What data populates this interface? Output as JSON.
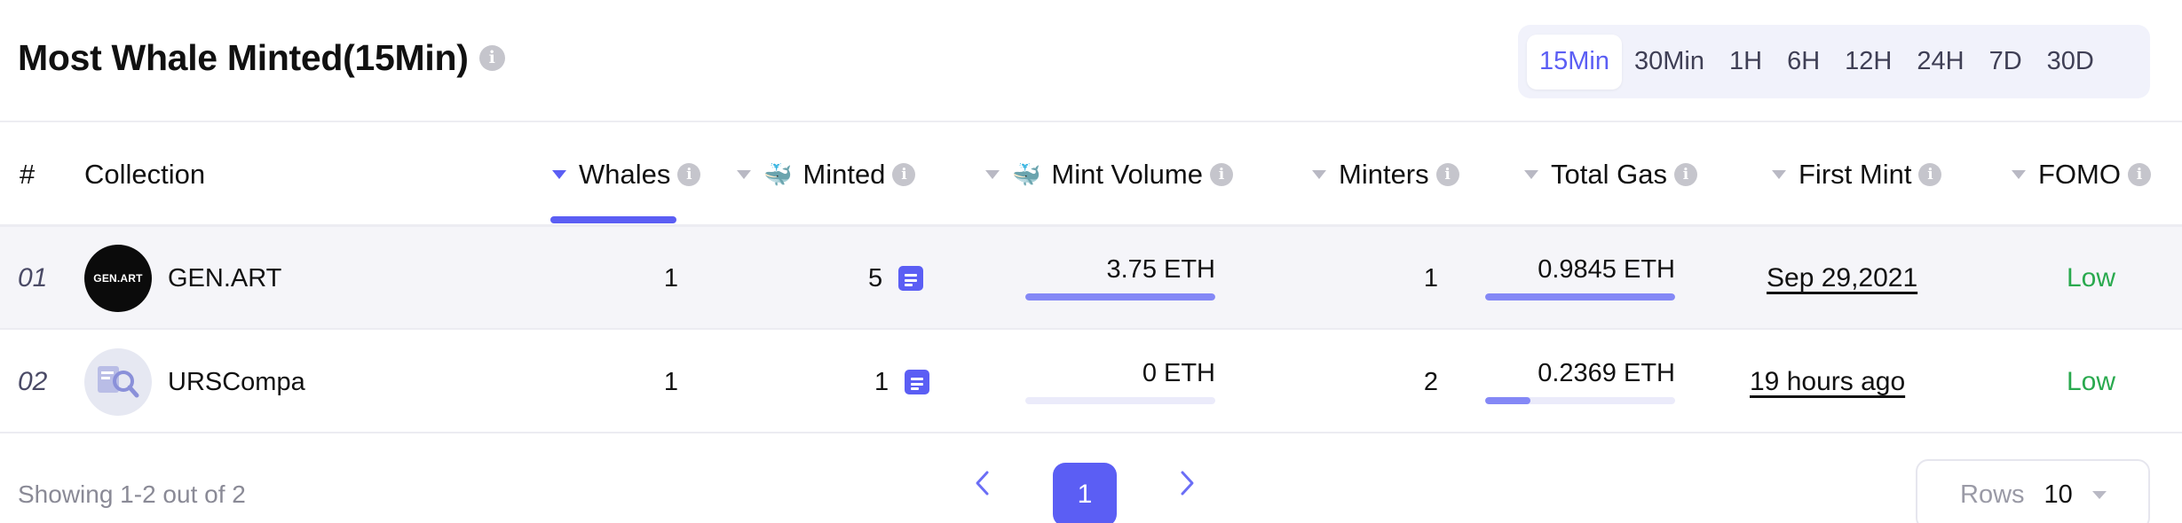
{
  "header": {
    "title": "Most Whale Minted(15Min)",
    "ranges": [
      "15Min",
      "30Min",
      "1H",
      "6H",
      "12H",
      "24H",
      "7D",
      "30D"
    ],
    "active_range": "15Min"
  },
  "table": {
    "columns": {
      "rank": "#",
      "collection": "Collection",
      "whales": "Whales",
      "minted": "Minted",
      "mint_volume": "Mint Volume",
      "minters": "Minters",
      "total_gas": "Total Gas",
      "first_mint": "First Mint",
      "fomo": "FOMO"
    },
    "sorted_by": "Whales",
    "rows": [
      {
        "rank": "01",
        "avatar_text": "GEN.ART",
        "collection": "GEN.ART",
        "whales": "1",
        "minted": "5",
        "mint_volume": "3.75 ETH",
        "mint_volume_fill": 1.0,
        "minters": "1",
        "total_gas": "0.9845 ETH",
        "total_gas_fill": 1.0,
        "first_mint": "Sep 29,2021",
        "fomo": "Low"
      },
      {
        "rank": "02",
        "avatar_text": "",
        "collection": "URSCompa",
        "whales": "1",
        "minted": "1",
        "mint_volume": "0 ETH",
        "mint_volume_fill": 0.0,
        "minters": "2",
        "total_gas": "0.2369 ETH",
        "total_gas_fill": 0.24,
        "first_mint": "19 hours ago",
        "fomo": "Low"
      }
    ]
  },
  "footer": {
    "showing": "Showing 1-2 out of 2",
    "current_page": "1",
    "rows_label": "Rows",
    "rows_value": "10"
  },
  "colors": {
    "accent": "#5b5ef4",
    "bar": "#8488f6",
    "fomo_low": "#29a94e"
  },
  "icons": [
    "info-icon",
    "sort-caret-icon",
    "whale-icon",
    "document-icon",
    "chevron-left-icon",
    "chevron-right-icon",
    "chevron-down-icon"
  ]
}
